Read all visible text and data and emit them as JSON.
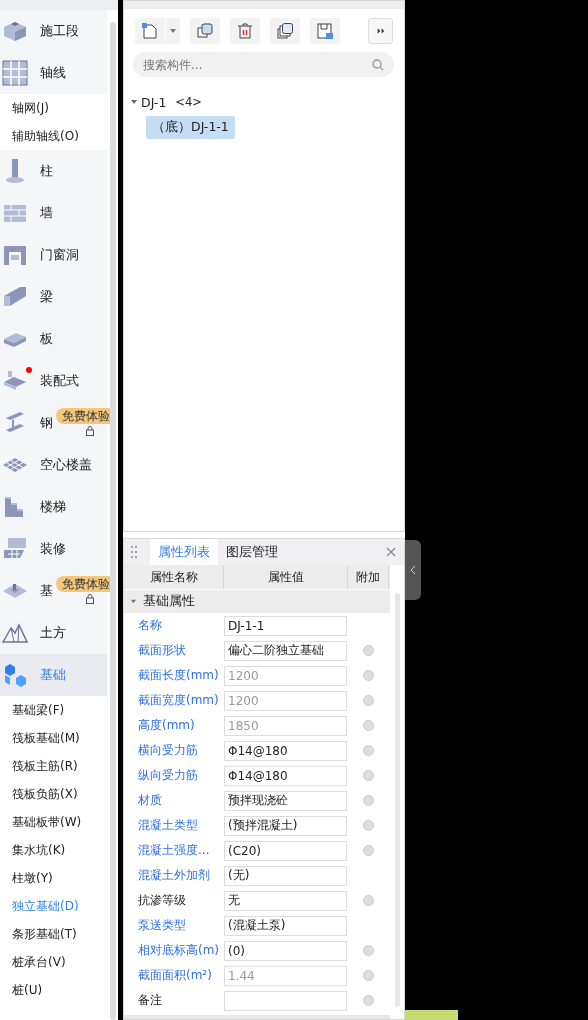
{
  "nav": {
    "items": [
      {
        "kind": "group",
        "label": "施工段",
        "selected": false,
        "new_dot": false
      },
      {
        "kind": "group",
        "label": "轴线",
        "selected": false,
        "new_dot": false
      },
      {
        "kind": "sub",
        "label": "轴网(J)",
        "selected": false
      },
      {
        "kind": "sub",
        "label": "辅助轴线(O)",
        "selected": false
      },
      {
        "kind": "group",
        "label": "柱",
        "selected": false,
        "new_dot": false
      },
      {
        "kind": "group",
        "label": "墙",
        "selected": false,
        "new_dot": false
      },
      {
        "kind": "group",
        "label": "门窗洞",
        "selected": false,
        "new_dot": false
      },
      {
        "kind": "group",
        "label": "梁",
        "selected": false,
        "new_dot": false
      },
      {
        "kind": "group",
        "label": "板",
        "selected": false,
        "new_dot": false
      },
      {
        "kind": "group",
        "label": "装配式",
        "selected": false,
        "new_dot": true
      },
      {
        "kind": "group",
        "label": "钢",
        "selected": false,
        "new_dot": false,
        "badge": "免费体验"
      },
      {
        "kind": "group",
        "label": "空心楼盖",
        "selected": false,
        "new_dot": false
      },
      {
        "kind": "group",
        "label": "楼梯",
        "selected": false,
        "new_dot": false
      },
      {
        "kind": "group",
        "label": "装修",
        "selected": false,
        "new_dot": false
      },
      {
        "kind": "group",
        "label": "基",
        "selected": false,
        "new_dot": false,
        "badge": "免费体验"
      },
      {
        "kind": "group",
        "label": "土方",
        "selected": false,
        "new_dot": false
      },
      {
        "kind": "group",
        "label": "基础",
        "selected": true,
        "new_dot": false
      },
      {
        "kind": "sub",
        "label": "基础梁(F)",
        "selected": false
      },
      {
        "kind": "sub",
        "label": "筏板基础(M)",
        "selected": false
      },
      {
        "kind": "sub",
        "label": "筏板主筋(R)",
        "selected": false
      },
      {
        "kind": "sub",
        "label": "筏板负筋(X)",
        "selected": false
      },
      {
        "kind": "sub",
        "label": "基础板带(W)",
        "selected": false
      },
      {
        "kind": "sub",
        "label": "集水坑(K)",
        "selected": false
      },
      {
        "kind": "sub",
        "label": "柱墩(Y)",
        "selected": false
      },
      {
        "kind": "sub",
        "label": "独立基础(D)",
        "selected": true
      },
      {
        "kind": "sub",
        "label": "条形基础(T)",
        "selected": false
      },
      {
        "kind": "sub",
        "label": "桩承台(V)",
        "selected": false
      },
      {
        "kind": "sub",
        "label": "桩(U)",
        "selected": false
      }
    ]
  },
  "components": {
    "search": {
      "placeholder": "搜索构件..."
    },
    "tree": [
      {
        "label": "DJ-1",
        "count": "<4>",
        "expanded": true,
        "children": [
          {
            "label": "（底）DJ-1-1",
            "selected": true
          }
        ]
      }
    ]
  },
  "properties": {
    "tabs": [
      {
        "label": "属性列表",
        "selected": true
      },
      {
        "label": "图层管理",
        "selected": false
      }
    ],
    "columns": [
      "属性名称",
      "属性值",
      "附加"
    ],
    "group": {
      "label": "基础属性",
      "expanded": true
    },
    "rows": [
      {
        "name": "名称",
        "highlighted": true,
        "value": "DJ-1-1",
        "disabled": false,
        "attach": false
      },
      {
        "name": "截面形状",
        "highlighted": true,
        "value": "偏心二阶独立基础",
        "disabled": false,
        "attach": true
      },
      {
        "name": "截面长度(mm)",
        "highlighted": true,
        "value": "1200",
        "disabled": true,
        "attach": true
      },
      {
        "name": "截面宽度(mm)",
        "highlighted": true,
        "value": "1200",
        "disabled": true,
        "attach": true
      },
      {
        "name": "高度(mm)",
        "highlighted": true,
        "value": "1850",
        "disabled": true,
        "attach": true
      },
      {
        "name": "横向受力筋",
        "highlighted": true,
        "value": "Φ14@180",
        "disabled": false,
        "attach": true
      },
      {
        "name": "纵向受力筋",
        "highlighted": true,
        "value": "Φ14@180",
        "disabled": false,
        "attach": true
      },
      {
        "name": "材质",
        "highlighted": true,
        "value": "预拌现浇砼",
        "disabled": false,
        "attach": true
      },
      {
        "name": "混凝土类型",
        "highlighted": true,
        "value": "(预拌混凝土)",
        "disabled": false,
        "attach": true
      },
      {
        "name": "混凝土强度...",
        "highlighted": true,
        "value": "(C20)",
        "disabled": false,
        "attach": true
      },
      {
        "name": "混凝土外加剂",
        "highlighted": true,
        "value": "(无)",
        "disabled": false,
        "attach": false
      },
      {
        "name": "抗渗等级",
        "highlighted": false,
        "value": "无",
        "disabled": false,
        "attach": true
      },
      {
        "name": "泵送类型",
        "highlighted": true,
        "value": "(混凝土泵)",
        "disabled": false,
        "attach": false
      },
      {
        "name": "相对底标高(m)",
        "highlighted": true,
        "value": "(0)",
        "disabled": false,
        "attach": true
      },
      {
        "name": "截面面积(m²)",
        "highlighted": true,
        "value": "1.44",
        "disabled": true,
        "attach": true
      },
      {
        "name": "备注",
        "highlighted": false,
        "value": "",
        "disabled": false,
        "attach": true
      }
    ]
  }
}
